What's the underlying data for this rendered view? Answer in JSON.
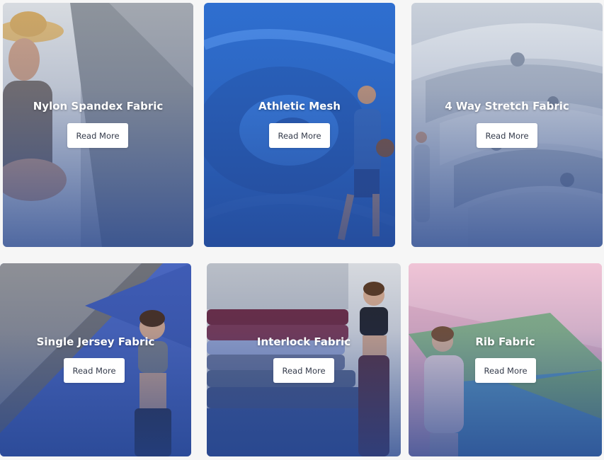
{
  "cards": [
    {
      "title": "Nylon Spandex Fabric",
      "button": "Read More"
    },
    {
      "title": "Athletic Mesh",
      "button": "Read More"
    },
    {
      "title": "4 Way Stretch Fabric",
      "button": "Read More"
    },
    {
      "title": "Single Jersey Fabric",
      "button": "Read More"
    },
    {
      "title": "Interlock Fabric",
      "button": "Read More"
    },
    {
      "title": "Rib Fabric",
      "button": "Read More"
    }
  ]
}
